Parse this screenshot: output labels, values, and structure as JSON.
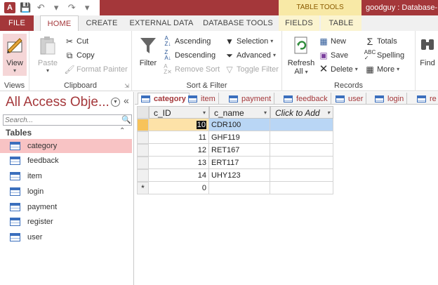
{
  "qat": {
    "logo": "A",
    "save": "💾",
    "undo": "↶",
    "redo": "↷"
  },
  "tools_label": "TABLE TOOLS",
  "window_title": "goodguy : Database-",
  "tabs": {
    "file": "FILE",
    "home": "HOME",
    "create": "CREATE",
    "external": "EXTERNAL DATA",
    "dbtools": "DATABASE TOOLS",
    "fields": "FIELDS",
    "table": "TABLE"
  },
  "ribbon": {
    "views": {
      "view": "View",
      "label": "Views"
    },
    "clipboard": {
      "paste": "Paste",
      "cut": "Cut",
      "copy": "Copy",
      "format_painter": "Format Painter",
      "label": "Clipboard"
    },
    "sort": {
      "filter": "Filter",
      "ascending": "Ascending",
      "descending": "Descending",
      "remove_sort": "Remove Sort",
      "selection": "Selection",
      "advanced": "Advanced",
      "toggle_filter": "Toggle Filter",
      "label": "Sort & Filter"
    },
    "records": {
      "refresh": "Refresh",
      "refresh_all": "All",
      "new": "New",
      "save": "Save",
      "delete": "Delete",
      "totals": "Totals",
      "spelling": "Spelling",
      "more": "More",
      "label": "Records"
    },
    "find": {
      "find": "Find"
    }
  },
  "nav": {
    "title": "All Access Obje...",
    "search_placeholder": "Search...",
    "section": "Tables",
    "items": [
      "category",
      "feedback",
      "item",
      "login",
      "payment",
      "register",
      "user"
    ],
    "selected": "category"
  },
  "doc_tabs": [
    "category",
    "item",
    "payment",
    "feedback",
    "user",
    "login",
    "re"
  ],
  "grid": {
    "headers": [
      "c_ID",
      "c_name",
      "Click to Add"
    ],
    "rows": [
      {
        "id": "10",
        "name": "CDR100"
      },
      {
        "id": "11",
        "name": "GHF119"
      },
      {
        "id": "12",
        "name": "RET167"
      },
      {
        "id": "13",
        "name": "ERT117"
      },
      {
        "id": "14",
        "name": "UHY123"
      }
    ],
    "new_row": {
      "marker": "*",
      "id": "0"
    }
  },
  "colors": {
    "accent": "#a4373a",
    "tools": "#f8e9a6",
    "selection": "#b9d6f5",
    "nav_selected": "#f8c3c4"
  }
}
